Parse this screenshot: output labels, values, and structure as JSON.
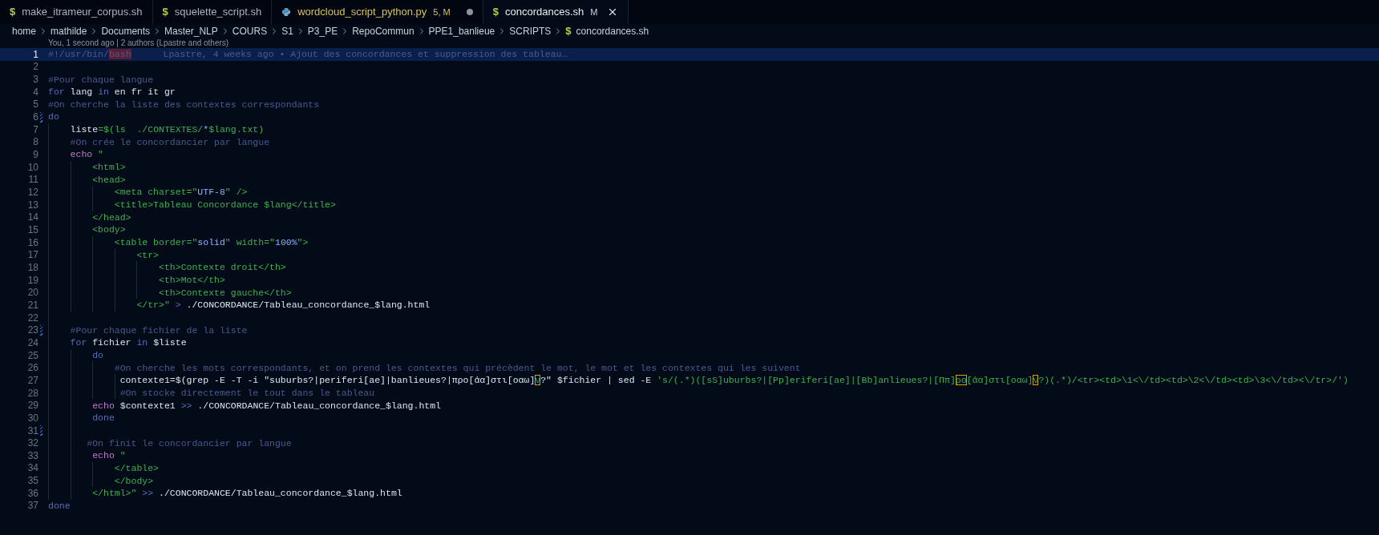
{
  "tabs": [
    {
      "label": "make_itrameur_corpus.sh",
      "kind": "shell",
      "glyph": "$",
      "selected": false,
      "has_problems": false,
      "dirty": false
    },
    {
      "label": "squelette_script.sh",
      "kind": "shell",
      "glyph": "$",
      "selected": false,
      "has_problems": false,
      "dirty": false
    },
    {
      "label": "wordcloud_script_python.py",
      "kind": "python",
      "selected": false,
      "has_problems": true,
      "badge": "5, M",
      "dirty": true
    },
    {
      "label": "concordances.sh",
      "kind": "shell",
      "glyph": "$",
      "selected": true,
      "has_problems": false,
      "badge": "M",
      "dirty": false
    }
  ],
  "breadcrumb": [
    {
      "label": "home"
    },
    {
      "label": "mathilde"
    },
    {
      "label": "Documents"
    },
    {
      "label": "Master_NLP"
    },
    {
      "label": "COURS"
    },
    {
      "label": "S1"
    },
    {
      "label": "P3_PE"
    },
    {
      "label": "RepoCommun"
    },
    {
      "label": "PPE1_banlieue"
    },
    {
      "label": "SCRIPTS"
    },
    {
      "label": "concordances.sh",
      "kind": "shell",
      "glyph": "$"
    }
  ],
  "codelens": "You, 1 second ago | 2 authors (Lpastre and others)",
  "lines": [
    {
      "number": "1",
      "current": true,
      "changed": false,
      "tokens": [
        {
          "text": "#!/usr/bin/",
          "kind": "comment"
        },
        {
          "text": "bash",
          "kind": "hl"
        }
      ],
      "blame": "Lpastre, 4 weeks ago • Ajout des concordances et suppression des tableau…"
    },
    {
      "number": "2",
      "current": false,
      "changed": false
    },
    {
      "number": "3",
      "current": false,
      "changed": false,
      "tokens": [
        {
          "text": "#Pour chaque langue",
          "kind": "comment"
        }
      ]
    },
    {
      "number": "4",
      "current": false,
      "changed": false,
      "tokens": [
        {
          "text": "for",
          "kind": "keyword"
        },
        {
          "text": " lang ",
          "kind": "plain"
        },
        {
          "text": "in",
          "kind": "keyword"
        },
        {
          "text": " en fr it gr",
          "kind": "plain"
        }
      ]
    },
    {
      "number": "5",
      "current": false,
      "changed": false,
      "tokens": [
        {
          "text": "#On cherche la liste des contextes correspondants",
          "kind": "comment"
        }
      ]
    },
    {
      "number": "6",
      "current": false,
      "changed": true,
      "tokens": [
        {
          "text": "do",
          "kind": "keyword"
        }
      ]
    },
    {
      "number": "7",
      "current": false,
      "changed": false,
      "tokens": [
        {
          "text": "    liste",
          "kind": "plain"
        },
        {
          "text": "=$(ls  ./CONTEXTES/",
          "kind": "str"
        },
        {
          "text": "*",
          "kind": "strq"
        },
        {
          "text": "$lang.txt)",
          "kind": "str"
        }
      ]
    },
    {
      "number": "8",
      "current": false,
      "changed": false,
      "tokens": [
        {
          "text": "    #On crée le concordancier par langue",
          "kind": "comment"
        }
      ]
    },
    {
      "number": "9",
      "current": false,
      "changed": false,
      "tokens": [
        {
          "text": "    echo",
          "kind": "echo"
        },
        {
          "text": " \"",
          "kind": "str"
        }
      ]
    },
    {
      "number": "10",
      "current": false,
      "changed": false,
      "tokens": [
        {
          "text": "        <html>",
          "kind": "str"
        }
      ]
    },
    {
      "number": "11",
      "current": false,
      "changed": false,
      "tokens": [
        {
          "text": "        <head>",
          "kind": "str"
        }
      ]
    },
    {
      "number": "12",
      "current": false,
      "changed": false,
      "tokens": [
        {
          "text": "            <meta charset=\"",
          "kind": "str"
        },
        {
          "text": "UTF-8",
          "kind": "strq"
        },
        {
          "text": "\" />",
          "kind": "str"
        }
      ]
    },
    {
      "number": "13",
      "current": false,
      "changed": false,
      "tokens": [
        {
          "text": "            <title>Tableau Concordance $lang</title>",
          "kind": "str"
        }
      ]
    },
    {
      "number": "14",
      "current": false,
      "changed": false,
      "tokens": [
        {
          "text": "        </head>",
          "kind": "str"
        }
      ]
    },
    {
      "number": "15",
      "current": false,
      "changed": false,
      "tokens": [
        {
          "text": "        <body>",
          "kind": "str"
        }
      ]
    },
    {
      "number": "16",
      "current": false,
      "changed": false,
      "tokens": [
        {
          "text": "            <table border=\"",
          "kind": "str"
        },
        {
          "text": "solid",
          "kind": "strq"
        },
        {
          "text": "\" width=\"",
          "kind": "str"
        },
        {
          "text": "100%",
          "kind": "strq"
        },
        {
          "text": "\">",
          "kind": "str"
        }
      ]
    },
    {
      "number": "17",
      "current": false,
      "changed": false,
      "tokens": [
        {
          "text": "                <tr>",
          "kind": "str"
        }
      ]
    },
    {
      "number": "18",
      "current": false,
      "changed": false,
      "tokens": [
        {
          "text": "                    <th>Contexte droit</th>",
          "kind": "str"
        }
      ]
    },
    {
      "number": "19",
      "current": false,
      "changed": false,
      "tokens": [
        {
          "text": "                    <th>Mot</th>",
          "kind": "str"
        }
      ]
    },
    {
      "number": "20",
      "current": false,
      "changed": false,
      "tokens": [
        {
          "text": "                    <th>Contexte gauche</th>",
          "kind": "str"
        }
      ]
    },
    {
      "number": "21",
      "current": false,
      "changed": false,
      "tokens": [
        {
          "text": "                </tr>\"",
          "kind": "str"
        },
        {
          "text": " > ",
          "kind": "op"
        },
        {
          "text": "./CONCORDANCE/Tableau_concordance_$lang.html",
          "kind": "plain"
        }
      ]
    },
    {
      "number": "22",
      "current": false,
      "changed": false
    },
    {
      "number": "23",
      "current": false,
      "changed": true,
      "tokens": [
        {
          "text": "    #Pour chaque fichier de la liste",
          "kind": "comment"
        }
      ]
    },
    {
      "number": "24",
      "current": false,
      "changed": false,
      "tokens": [
        {
          "text": "    for",
          "kind": "keyword"
        },
        {
          "text": " fichier ",
          "kind": "plain"
        },
        {
          "text": "in",
          "kind": "keyword"
        },
        {
          "text": " $liste",
          "kind": "plain"
        }
      ]
    },
    {
      "number": "25",
      "current": false,
      "changed": false,
      "tokens": [
        {
          "text": "        do",
          "kind": "keyword"
        }
      ]
    },
    {
      "number": "26",
      "current": false,
      "changed": false,
      "tokens": [
        {
          "text": "            #On cherche les mots correspondants, et on prend les contextes qui précèdent le mot, le mot et les contextes qui les suivent",
          "kind": "comment"
        }
      ]
    },
    {
      "number": "27",
      "current": false,
      "changed": false,
      "tokens": [
        {
          "text": "             contexte1=$(grep -E -T -i \"suburbs?|periferi[ae]|banlieues?|προ[άα]στι[οαω]",
          "kind": "plain"
        },
        {
          "text": "ν",
          "kind": "amb"
        },
        {
          "text": "?\" $fichier | sed -E ",
          "kind": "plain"
        },
        {
          "text": "'s/(.*)([sS]uburbs?|[Pp]eriferi[ae]|[Bb]anlieues?|[Ππ]",
          "kind": "str"
        },
        {
          "text": "ρο",
          "kind": "amb"
        },
        {
          "text": "[άα]στι[οαω]",
          "kind": "str"
        },
        {
          "text": "ν",
          "kind": "amb"
        },
        {
          "text": "?)(.*)/<tr><td>\\1<\\/td><td>\\2<\\/td><td>\\3<\\/td><\\/tr>/')",
          "kind": "str"
        }
      ]
    },
    {
      "number": "28",
      "current": false,
      "changed": false,
      "tokens": [
        {
          "text": "             #On stocke directement le tout dans le tableau",
          "kind": "comment"
        }
      ]
    },
    {
      "number": "29",
      "current": false,
      "changed": false,
      "tokens": [
        {
          "text": "        echo",
          "kind": "echo"
        },
        {
          "text": " $contexte1 ",
          "kind": "plain"
        },
        {
          "text": ">>",
          "kind": "op"
        },
        {
          "text": " ./CONCORDANCE/Tableau_concordance_$lang.html",
          "kind": "plain"
        }
      ]
    },
    {
      "number": "30",
      "current": false,
      "changed": false,
      "tokens": [
        {
          "text": "        done",
          "kind": "keyword"
        }
      ]
    },
    {
      "number": "31",
      "current": false,
      "changed": true
    },
    {
      "number": "32",
      "current": false,
      "changed": false,
      "tokens": [
        {
          "text": "       #On finit le concordancier par langue",
          "kind": "comment"
        }
      ]
    },
    {
      "number": "33",
      "current": false,
      "changed": false,
      "tokens": [
        {
          "text": "        echo",
          "kind": "echo"
        },
        {
          "text": " \"",
          "kind": "str"
        }
      ]
    },
    {
      "number": "34",
      "current": false,
      "changed": false,
      "tokens": [
        {
          "text": "            </table>",
          "kind": "str"
        }
      ]
    },
    {
      "number": "35",
      "current": false,
      "changed": false,
      "tokens": [
        {
          "text": "            </body>",
          "kind": "str"
        }
      ]
    },
    {
      "number": "36",
      "current": false,
      "changed": false,
      "tokens": [
        {
          "text": "        </html>\"",
          "kind": "str"
        },
        {
          "text": " >> ",
          "kind": "op"
        },
        {
          "text": "./CONCORDANCE/Tableau_concordance_$lang.html",
          "kind": "plain"
        }
      ]
    },
    {
      "number": "37",
      "current": false,
      "changed": false,
      "tokens": [
        {
          "text": "done",
          "kind": "keyword"
        }
      ]
    }
  ]
}
